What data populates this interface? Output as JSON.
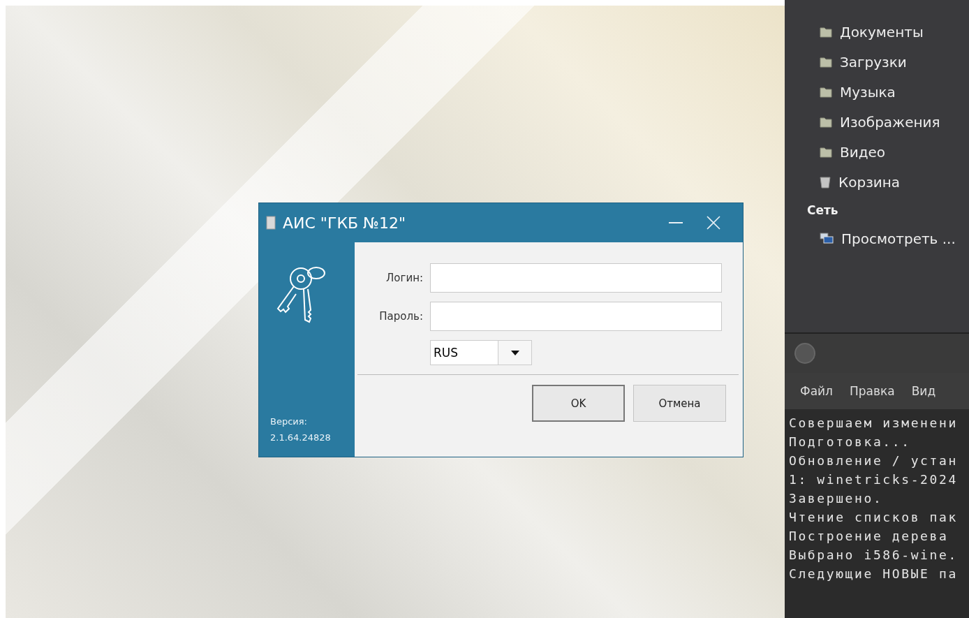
{
  "dialog": {
    "title": "АИС \"ГКБ №12\"",
    "version_label": "Версия:",
    "version": "2.1.64.24828",
    "fields": [
      {
        "label": "Логин:"
      },
      {
        "label": "Пароль:"
      }
    ],
    "language": {
      "value": "RUS"
    },
    "buttons": [
      {
        "label": "OK",
        "default": true
      },
      {
        "label": "Отмена",
        "default": false
      }
    ]
  },
  "file_manager": {
    "places": [
      {
        "label": "Документы",
        "kind": "folder"
      },
      {
        "label": "Загрузки",
        "kind": "folder"
      },
      {
        "label": "Музыка",
        "kind": "folder"
      },
      {
        "label": "Изображения",
        "kind": "folder"
      },
      {
        "label": "Видео",
        "kind": "folder"
      },
      {
        "label": "Корзина",
        "kind": "trash"
      }
    ],
    "network_heading": "Сеть",
    "network_items": [
      {
        "label": "Просмотреть ...",
        "kind": "network"
      }
    ]
  },
  "terminal": {
    "menu": [
      "Файл",
      "Правка",
      "Вид"
    ],
    "lines": [
      "Совершаем изменени",
      "Подготовка...",
      "Обновление / устан",
      "1: winetricks-2024",
      "Завершено.",
      "Чтение списков пак",
      "Построение дерева",
      "Выбрано i586-wine.",
      "Следующие НОВЫЕ па"
    ]
  }
}
